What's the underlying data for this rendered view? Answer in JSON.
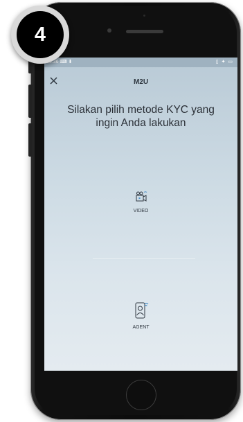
{
  "badge": {
    "step": "4"
  },
  "status_bar": {
    "time": "10:36 ⌨ ⬇",
    "icons": "▯ ✦ ▭"
  },
  "header": {
    "title": "M2U",
    "close_icon": "close-icon"
  },
  "prompt": {
    "line1": "Silakan pilih metode KYC yang",
    "line2": "ingin Anda lakukan"
  },
  "methods": [
    {
      "label": "VIDEO",
      "icon": "video-camera-icon"
    },
    {
      "label": "AGENT",
      "icon": "agent-phone-icon"
    }
  ],
  "colors": {
    "accent": "#4a90c8",
    "screen_top": "#b9cad6",
    "screen_bottom": "#e4ebf0"
  }
}
